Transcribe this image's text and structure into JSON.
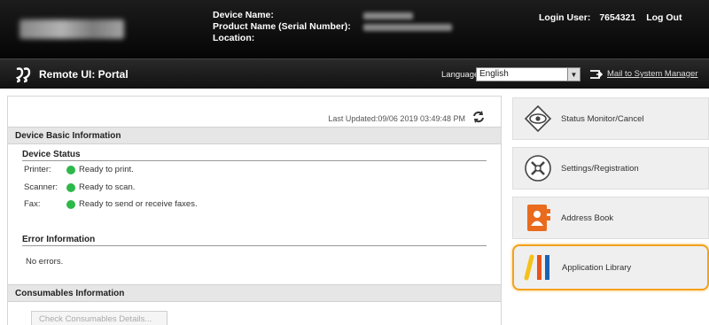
{
  "header": {
    "device_name_label": "Device Name:",
    "product_name_label": "Product Name (Serial Number):",
    "location_label": "Location:",
    "login_user_label": "Login User:",
    "login_user_value": "7654321",
    "logout_label": "Log Out"
  },
  "portal": {
    "title": "Remote UI: Portal",
    "language_label": "Language:",
    "language_value": "English",
    "mail_link": "Mail to System Manager"
  },
  "main": {
    "last_updated": "Last Updated:09/06 2019 03:49:48 PM",
    "device_basic_info": "Device Basic Information",
    "device_status": "Device Status",
    "statuses": [
      {
        "label": "Printer:",
        "text": "Ready to print."
      },
      {
        "label": "Scanner:",
        "text": "Ready to scan."
      },
      {
        "label": "Fax:",
        "text": "Ready to send or receive faxes."
      }
    ],
    "error_info": "Error Information",
    "error_text": "No errors.",
    "consumables_info": "Consumables Information",
    "check_consumables": "Check Consumables Details..."
  },
  "menu": {
    "items": [
      {
        "label": "Status Monitor/Cancel",
        "icon": "eye-icon"
      },
      {
        "label": "Settings/Registration",
        "icon": "gear-icon"
      },
      {
        "label": "Address Book",
        "icon": "address-book-icon"
      },
      {
        "label": "Application Library",
        "icon": "application-library-icon"
      }
    ]
  },
  "colors": {
    "status_ready": "#2db84a",
    "highlight": "#f2a21c"
  }
}
